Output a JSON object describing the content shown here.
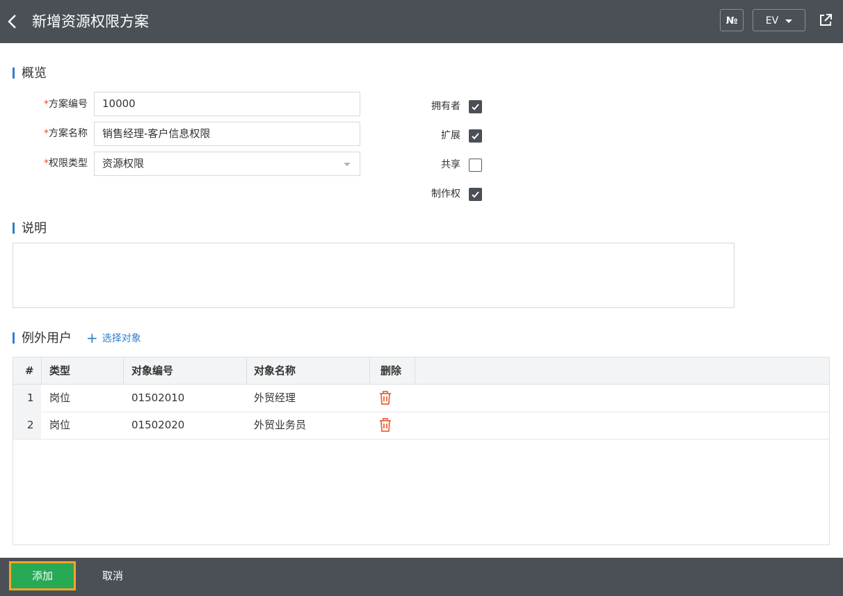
{
  "header": {
    "title": "新增资源权限方案",
    "no_label": "№",
    "lang_label": "EV"
  },
  "overview": {
    "section_title": "概览",
    "fields": [
      {
        "label": "方案编号",
        "value": "10000",
        "required": true
      },
      {
        "label": "方案名称",
        "value": "销售经理-客户信息权限",
        "required": true
      },
      {
        "label": "权限类型",
        "value": "资源权限",
        "required": true
      }
    ],
    "checkboxes": [
      {
        "label": "拥有者",
        "checked": true
      },
      {
        "label": "扩展",
        "checked": true
      },
      {
        "label": "共享",
        "checked": false
      },
      {
        "label": "制作权",
        "checked": true
      }
    ]
  },
  "description": {
    "section_title": "说明",
    "value": ""
  },
  "exceptions": {
    "section_title": "例外用户",
    "select_label": "选择对象",
    "columns": [
      "#",
      "类型",
      "对象编号",
      "对象名称",
      "删除"
    ],
    "rows": [
      {
        "num": "1",
        "type": "岗位",
        "code": "01502010",
        "name": "外贸经理"
      },
      {
        "num": "2",
        "type": "岗位",
        "code": "01502020",
        "name": "外贸业务员"
      }
    ]
  },
  "footer": {
    "add_label": "添加",
    "cancel_label": "取消"
  },
  "colors": {
    "header_bg": "#4b5057",
    "accent": "#2d7fd0",
    "add_button": "#27a956",
    "add_button_outline": "#f5a623",
    "delete_icon": "#e8663d",
    "required_mark": "#e74c3c"
  }
}
